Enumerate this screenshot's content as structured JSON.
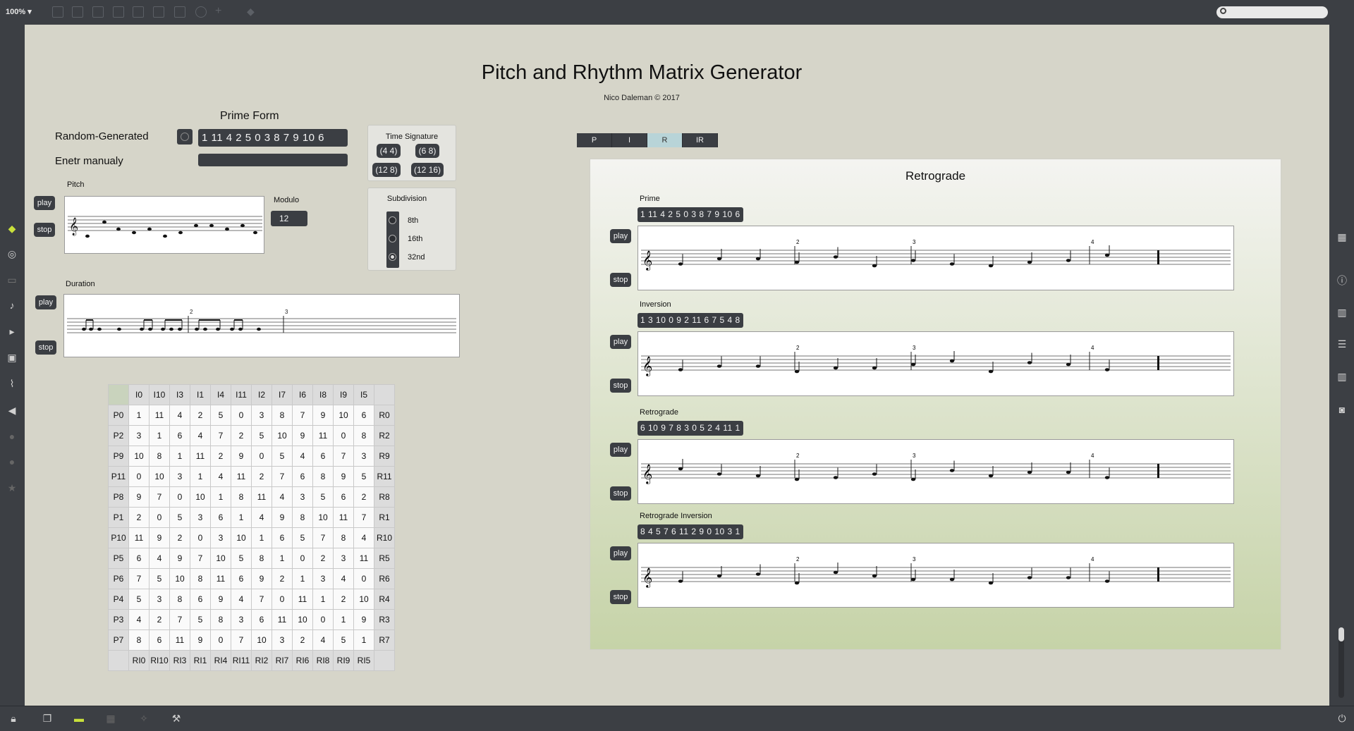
{
  "toolbar": {
    "zoom": "100%"
  },
  "patch": {
    "title": "Pitch and Rhythm Matrix Generator",
    "credit": "Nico Daleman © 2017"
  },
  "prime_form": {
    "heading": "Prime Form",
    "random_label": "Random-Generated",
    "random_value": "1 11 4 2 5 0 3 8 7 9 10 6",
    "manual_label": "Enetr manualy",
    "manual_value": ""
  },
  "pitch": {
    "label": "Pitch",
    "play": "play",
    "stop": "stop"
  },
  "modulo": {
    "label": "Modulo",
    "value": "12"
  },
  "duration": {
    "label": "Duration",
    "play": "play",
    "stop": "stop",
    "measure_2": "2",
    "measure_3": "3"
  },
  "time_signature": {
    "label": "Time Signature",
    "options": [
      "(4 4)",
      "(6 8)",
      "(12 8)",
      "(12 16)"
    ]
  },
  "subdivision": {
    "label": "Subdivision",
    "options": [
      "8th",
      "16th",
      "32nd"
    ],
    "selected": "32nd"
  },
  "matrix": {
    "top_headers": [
      "I0",
      "I10",
      "I3",
      "I1",
      "I4",
      "I11",
      "I2",
      "I7",
      "I6",
      "I8",
      "I9",
      "I5"
    ],
    "bottom_headers": [
      "RI0",
      "RI10",
      "RI3",
      "RI1",
      "RI4",
      "RI11",
      "RI2",
      "RI7",
      "RI6",
      "RI8",
      "RI9",
      "RI5"
    ],
    "rows": [
      {
        "p": "P0",
        "r": "R0",
        "v": [
          1,
          11,
          4,
          2,
          5,
          0,
          3,
          8,
          7,
          9,
          10,
          6
        ]
      },
      {
        "p": "P2",
        "r": "R2",
        "v": [
          3,
          1,
          6,
          4,
          7,
          2,
          5,
          10,
          9,
          11,
          0,
          8
        ]
      },
      {
        "p": "P9",
        "r": "R9",
        "v": [
          10,
          8,
          1,
          11,
          2,
          9,
          0,
          5,
          4,
          6,
          7,
          3
        ]
      },
      {
        "p": "P11",
        "r": "R11",
        "v": [
          0,
          10,
          3,
          1,
          4,
          11,
          2,
          7,
          6,
          8,
          9,
          5
        ]
      },
      {
        "p": "P8",
        "r": "R8",
        "v": [
          9,
          7,
          0,
          10,
          1,
          8,
          11,
          4,
          3,
          5,
          6,
          2
        ]
      },
      {
        "p": "P1",
        "r": "R1",
        "v": [
          2,
          0,
          5,
          3,
          6,
          1,
          4,
          9,
          8,
          10,
          11,
          7
        ]
      },
      {
        "p": "P10",
        "r": "R10",
        "v": [
          11,
          9,
          2,
          0,
          3,
          10,
          1,
          6,
          5,
          7,
          8,
          4
        ]
      },
      {
        "p": "P5",
        "r": "R5",
        "v": [
          6,
          4,
          9,
          7,
          10,
          5,
          8,
          1,
          0,
          2,
          3,
          11
        ]
      },
      {
        "p": "P6",
        "r": "R6",
        "v": [
          7,
          5,
          10,
          8,
          11,
          6,
          9,
          2,
          1,
          3,
          4,
          0
        ]
      },
      {
        "p": "P4",
        "r": "R4",
        "v": [
          5,
          3,
          8,
          6,
          9,
          4,
          7,
          0,
          11,
          1,
          2,
          10
        ]
      },
      {
        "p": "P3",
        "r": "R3",
        "v": [
          4,
          2,
          7,
          5,
          8,
          3,
          6,
          11,
          10,
          0,
          1,
          9
        ]
      },
      {
        "p": "P7",
        "r": "R7",
        "v": [
          8,
          6,
          11,
          9,
          0,
          7,
          10,
          3,
          2,
          4,
          5,
          1
        ]
      }
    ]
  },
  "tabs": [
    {
      "label": "P",
      "active": false
    },
    {
      "label": "I",
      "active": false
    },
    {
      "label": "R",
      "active": true
    },
    {
      "label": "IR",
      "active": false
    }
  ],
  "retrograde": {
    "heading": "Retrograde",
    "rows": [
      {
        "label": "Prime",
        "value": "1 11 4 2 5 0 3 8 7 9 10 6",
        "play": "play",
        "stop": "stop"
      },
      {
        "label": "Inversion",
        "value": "1 3 10 0 9 2 11 6 7 5 4 8",
        "play": "play",
        "stop": "stop"
      },
      {
        "label": "Retrograde",
        "value": "6 10 9 7 8 3 0 5 2 4 11 1",
        "play": "play",
        "stop": "stop"
      },
      {
        "label": "Retrograde Inversion",
        "value": "8 4 5 7 6 11 2 9 0 10 3 1",
        "play": "play",
        "stop": "stop"
      }
    ],
    "measure_numbers": [
      "2",
      "3",
      "4"
    ]
  },
  "colors": {
    "canvas": "#d6d5c9",
    "chrome": "#3c3f44",
    "active_tab": "#b8d4d8",
    "accent_cube": "#c9e03b"
  }
}
